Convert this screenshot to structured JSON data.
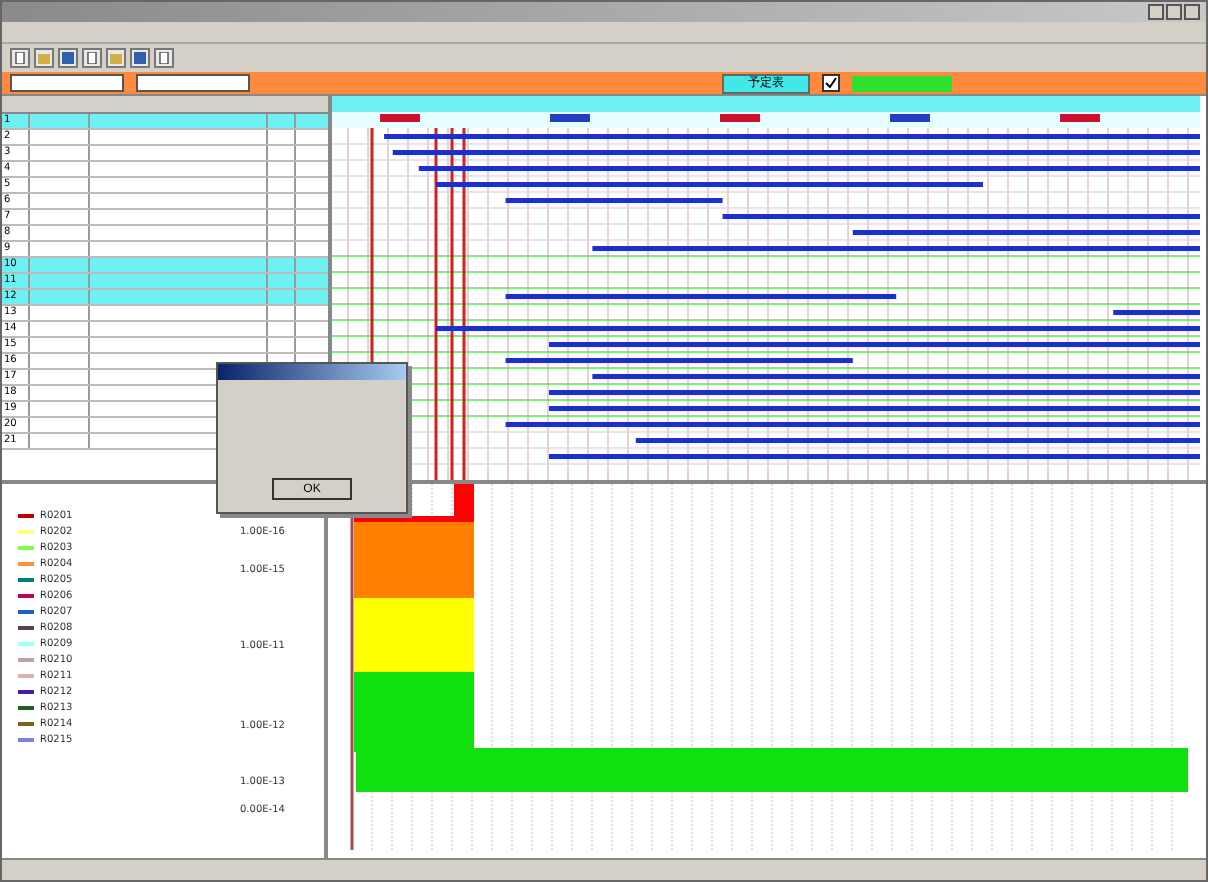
{
  "toolbar": {
    "buttons": [
      {
        "kind": "page"
      },
      {
        "kind": "folder"
      },
      {
        "kind": "disk"
      },
      {
        "kind": "page"
      },
      {
        "kind": "folder"
      },
      {
        "kind": "disk"
      },
      {
        "kind": "page"
      }
    ]
  },
  "filter_bar": {
    "view_button": {
      "label": "予定表",
      "selected": true
    },
    "show_checkbox": {
      "checked": true
    }
  },
  "table": {
    "rows": [
      {
        "no": "1",
        "selected": true
      },
      {
        "no": "2",
        "selected": false
      },
      {
        "no": "3",
        "selected": false
      },
      {
        "no": "4",
        "selected": false
      },
      {
        "no": "5",
        "selected": false
      },
      {
        "no": "6",
        "selected": false
      },
      {
        "no": "7",
        "selected": false
      },
      {
        "no": "8",
        "selected": false
      },
      {
        "no": "9",
        "selected": false
      },
      {
        "no": "10",
        "selected": true
      },
      {
        "no": "11",
        "selected": true
      },
      {
        "no": "12",
        "selected": true
      },
      {
        "no": "13",
        "selected": false
      },
      {
        "no": "14",
        "selected": false
      },
      {
        "no": "15",
        "selected": false
      },
      {
        "no": "16",
        "selected": false
      },
      {
        "no": "17",
        "selected": false
      },
      {
        "no": "18",
        "selected": false
      },
      {
        "no": "19",
        "selected": false
      },
      {
        "no": "20",
        "selected": false
      },
      {
        "no": "21",
        "selected": false
      }
    ]
  },
  "legend": {
    "items": [
      {
        "label": "R0201",
        "color": "#c00000"
      },
      {
        "label": "R0202",
        "color": "#ffff80"
      },
      {
        "label": "R0203",
        "color": "#80ff40"
      },
      {
        "label": "R0204",
        "color": "#ff9040"
      },
      {
        "label": "R0205",
        "color": "#008080"
      },
      {
        "label": "R0206",
        "color": "#c00060"
      },
      {
        "label": "R0207",
        "color": "#2060c0"
      },
      {
        "label": "R0208",
        "color": "#604040"
      },
      {
        "label": "R0209",
        "color": "#a0ffff"
      },
      {
        "label": "R0210",
        "color": "#c0a0a0"
      },
      {
        "label": "R0211",
        "color": "#e0b0b0"
      },
      {
        "label": "R0212",
        "color": "#4020a0"
      },
      {
        "label": "R0213",
        "color": "#206020"
      },
      {
        "label": "R0214",
        "color": "#806020"
      },
      {
        "label": "R0215",
        "color": "#8080e0"
      }
    ]
  },
  "level_chart": {
    "y_labels": [
      "1.00E-16",
      "1.00E-15",
      "1.00E-11",
      "1.00E-12",
      "1.00E-13",
      "0.00E-14"
    ]
  },
  "dialog": {
    "button": "OK"
  }
}
